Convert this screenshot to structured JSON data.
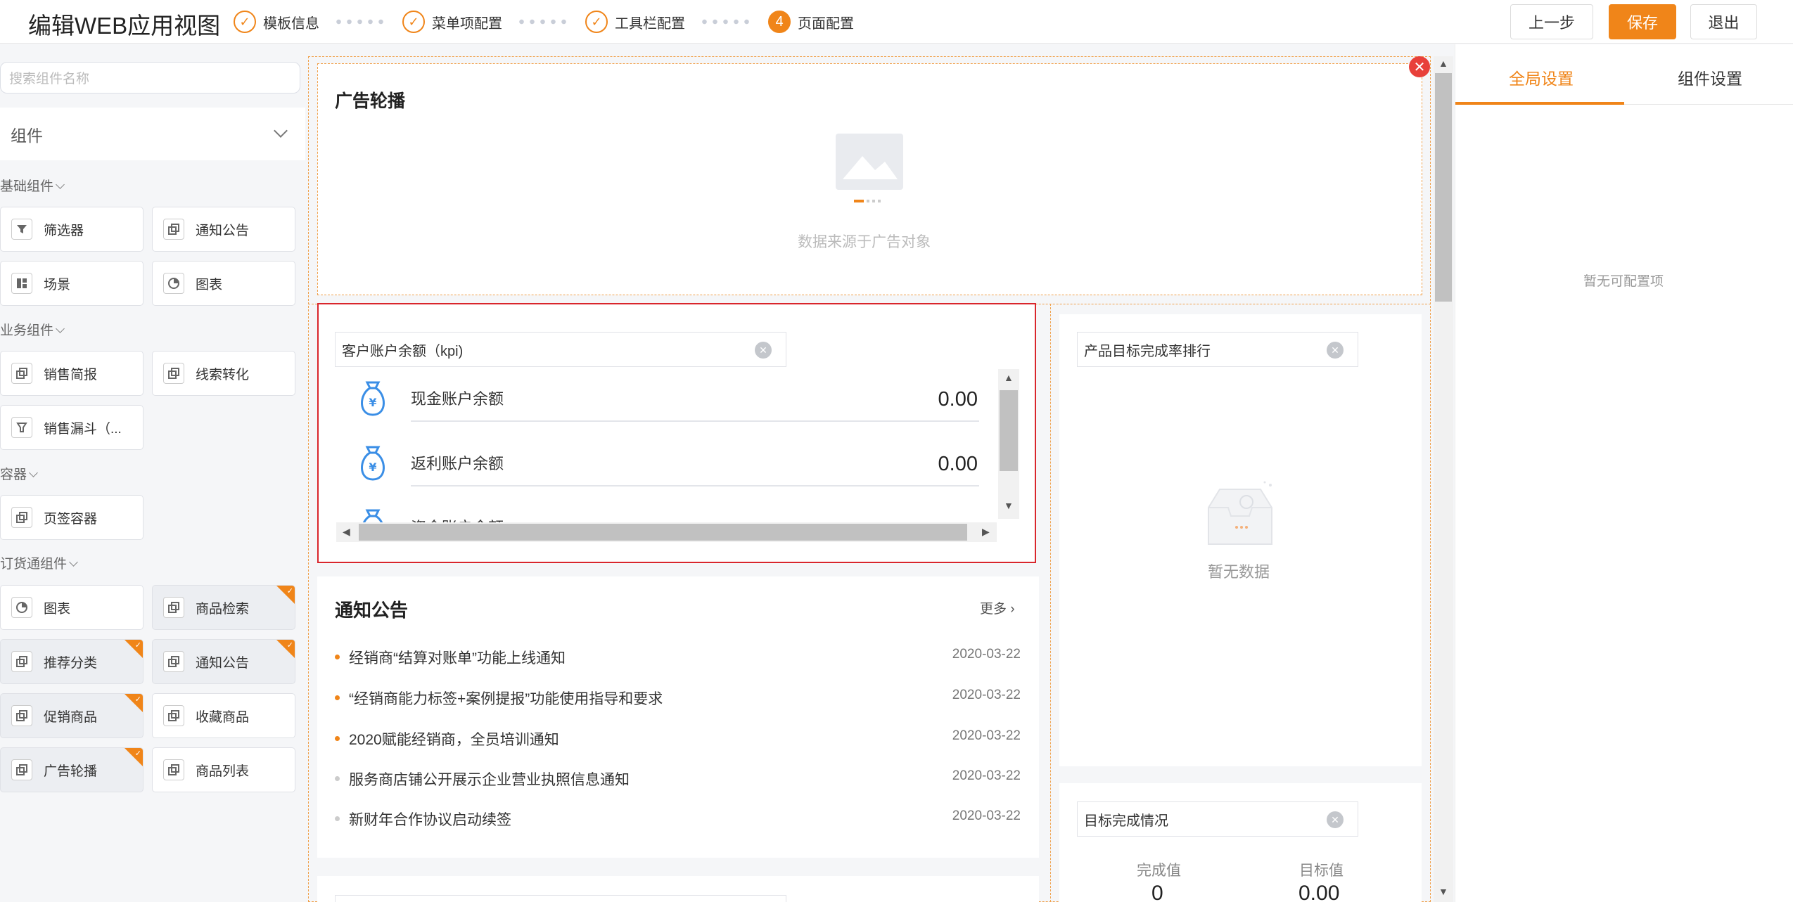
{
  "header": {
    "title": "编辑WEB应用视图",
    "steps": [
      {
        "label": "模板信息",
        "icon": "check-icon"
      },
      {
        "label": "菜单项配置",
        "icon": "check-icon"
      },
      {
        "label": "工具栏配置",
        "icon": "check-icon"
      },
      {
        "label": "页面配置",
        "number": "4"
      }
    ],
    "prev_label": "上一步",
    "save_label": "保存",
    "exit_label": "退出"
  },
  "left": {
    "search_placeholder": "搜索组件名称",
    "group_label": "组件",
    "sections": [
      {
        "label": "基础组件",
        "items": [
          {
            "label": "筛选器",
            "icon": "filter-icon"
          },
          {
            "label": "通知公告",
            "icon": "component-icon"
          },
          {
            "label": "场景",
            "icon": "layout-icon"
          },
          {
            "label": "图表",
            "icon": "pie-chart-icon"
          }
        ]
      },
      {
        "label": "业务组件",
        "items": [
          {
            "label": "销售简报",
            "icon": "component-icon"
          },
          {
            "label": "线索转化",
            "icon": "component-icon"
          },
          {
            "label": "销售漏斗（...",
            "icon": "funnel-icon"
          }
        ]
      },
      {
        "label": "容器",
        "items": [
          {
            "label": "页签容器",
            "icon": "component-icon"
          }
        ]
      },
      {
        "label": "订货通组件",
        "items": [
          {
            "label": "图表",
            "icon": "pie-chart-icon",
            "added": false
          },
          {
            "label": "商品检索",
            "icon": "component-icon",
            "added": true
          },
          {
            "label": "推荐分类",
            "icon": "component-icon",
            "added": true
          },
          {
            "label": "通知公告",
            "icon": "component-icon",
            "added": true
          },
          {
            "label": "促销商品",
            "icon": "component-icon",
            "added": true
          },
          {
            "label": "收藏商品",
            "icon": "component-icon",
            "added": false
          },
          {
            "label": "广告轮播",
            "icon": "component-icon",
            "added": true
          },
          {
            "label": "商品列表",
            "icon": "component-icon",
            "added": false
          }
        ]
      }
    ]
  },
  "canvas": {
    "banner": {
      "title": "广告轮播",
      "placeholder": "数据来源于广告对象"
    },
    "kpi": {
      "field_label": "客户账户余额（kpi)",
      "items": [
        {
          "label": "现金账户余额",
          "value": "0.00"
        },
        {
          "label": "返利账户余额",
          "value": "0.00"
        },
        {
          "label": "资金账户余额",
          "value": ""
        }
      ]
    },
    "ranking": {
      "field_label": "产品目标完成率排行",
      "empty_text": "暂无数据"
    },
    "notice": {
      "title": "通知公告",
      "more_label": "更多",
      "rows": [
        {
          "text": "经销商“结算对账单”功能上线通知",
          "date": "2020-03-22",
          "highlight": true
        },
        {
          "text": "“经销商能力标签+案例提报”功能使用指导和要求",
          "date": "2020-03-22",
          "highlight": true
        },
        {
          "text": "2020赋能经销商，全员培训通知",
          "date": "2020-03-22",
          "highlight": true
        },
        {
          "text": "服务商店铺公开展示企业营业执照信息通知",
          "date": "2020-03-22",
          "highlight": false
        },
        {
          "text": "新财年合作协议启动续签",
          "date": "2020-03-22",
          "highlight": false
        }
      ]
    },
    "target": {
      "field_label": "目标完成情况",
      "done_label": "完成值",
      "done_value": "0",
      "target_label": "目标值",
      "target_value": "0.00"
    }
  },
  "right": {
    "tab_global": "全局设置",
    "tab_component": "组件设置",
    "empty_text": "暂无可配置项"
  },
  "colors": {
    "accent": "#f08519",
    "selected_border": "#d9262c",
    "close": "#e8403a"
  }
}
